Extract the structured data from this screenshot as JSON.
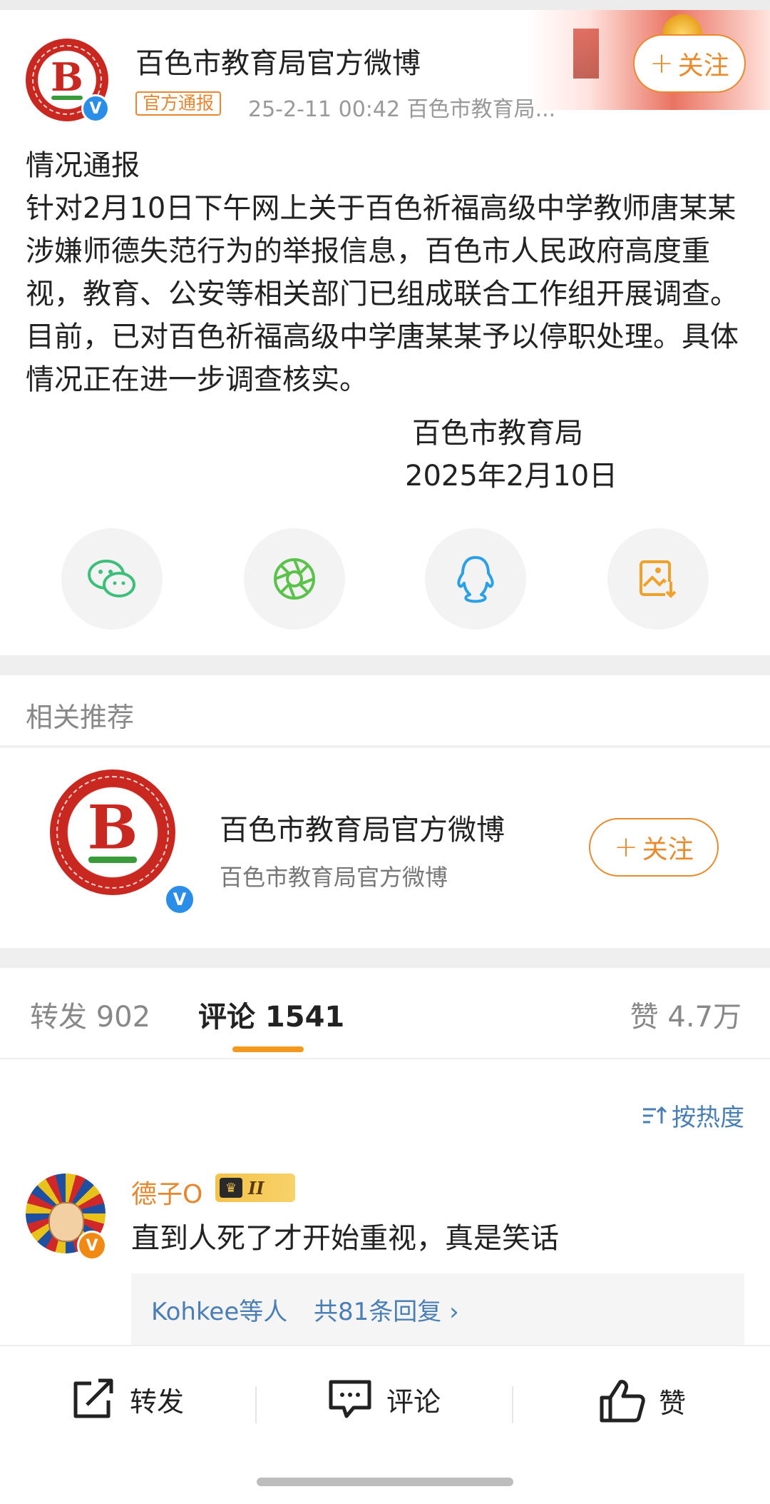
{
  "post": {
    "author": "百色市教育局官方微博",
    "tag": "官方通报",
    "meta": "25-2-11 00:42  百色市教育局...",
    "follow_label": "关注",
    "title_line": "情况通报",
    "body": "针对2月10日下午网上关于百色祈福高级中学教师唐某某涉嫌师德失范行为的举报信息，百色市人民政府高度重视，教育、公安等相关部门已组成联合工作组开展调查。目前，已对百色祈福高级中学唐某某予以停职处理。具体情况正在进一步调查核实。",
    "signature_org": "百色市教育局",
    "signature_date": "2025年2月10日",
    "avatar_text": "B",
    "share_icons": [
      "wechat-icon",
      "moments-icon",
      "qq-icon",
      "save-image-icon"
    ]
  },
  "recommend": {
    "heading": "相关推荐",
    "name": "百色市教育局官方微博",
    "subtitle": "百色市教育局官方微博",
    "follow_label": "关注",
    "avatar_text": "B"
  },
  "tabs": {
    "repost": "转发 902",
    "comment": "评论 1541",
    "like": "赞 4.7万"
  },
  "comments": {
    "sort_label": "按热度",
    "items": [
      {
        "user": "德子O",
        "level": "II",
        "text": "直到人死了才开始重视，真是笑话",
        "reply_users": "Kohkee等人",
        "reply_count": "共81条回复 ›"
      }
    ]
  },
  "bottom_bar": {
    "repost": "转发",
    "comment": "评论",
    "like": "赞"
  },
  "colors": {
    "accent_orange": "#e98a2c",
    "link_blue": "#4a7fb5",
    "logo_red": "#c8281f"
  }
}
